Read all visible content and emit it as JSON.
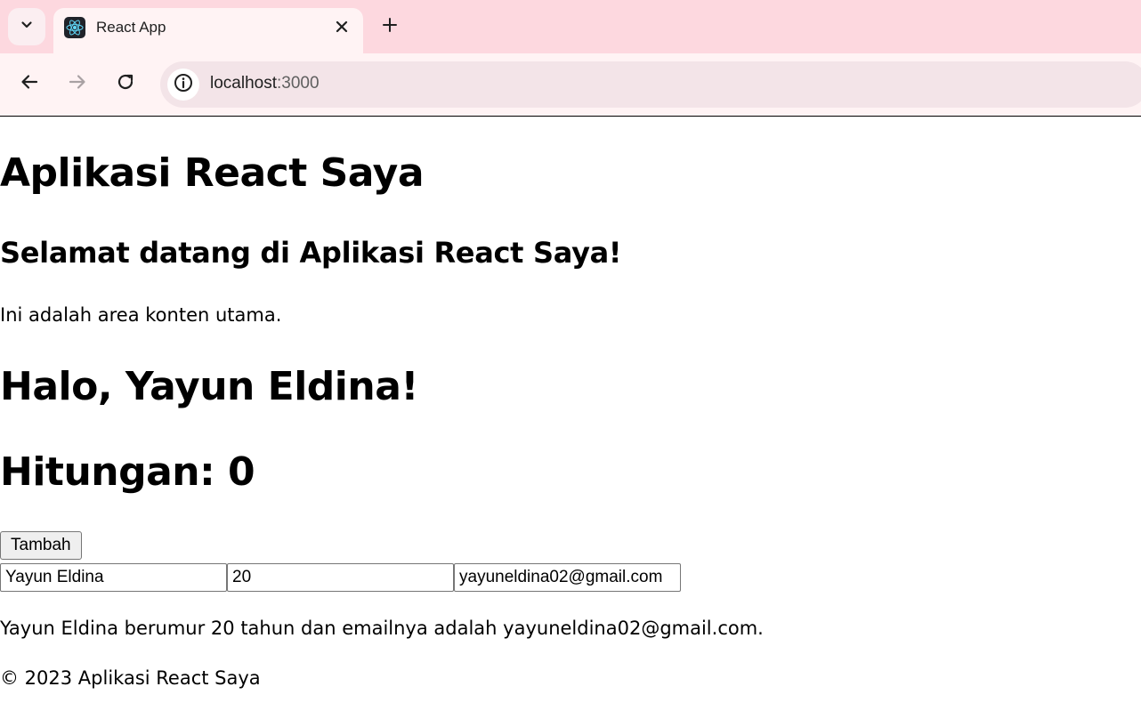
{
  "browser": {
    "tab": {
      "title": "React App",
      "favicon": "react-logo-icon"
    },
    "address_bar": {
      "host": "localhost",
      "port": ":3000"
    },
    "icons": {
      "tab_search": "chevron-down-icon",
      "close_tab": "close-icon",
      "new_tab": "plus-icon",
      "back": "arrow-left-icon",
      "forward": "arrow-right-icon",
      "reload": "reload-icon",
      "site_info": "info-icon"
    },
    "colors": {
      "tabstrip": "#fdd8df",
      "toolbar": "#fff3f4",
      "omnibox": "#f3e4e8",
      "react": "#61dafb"
    }
  },
  "page": {
    "app_title": "Aplikasi React Saya",
    "welcome_heading": "Selamat datang di Aplikasi React Saya!",
    "intro_text": "Ini adalah area konten utama.",
    "greeting": "Halo, Yayun Eldina!",
    "counter_label": "Hitungan: ",
    "counter_value": "0",
    "add_button_label": "Tambah",
    "form": {
      "name_value": "Yayun Eldina",
      "age_value": "20",
      "email_value": "yayuneldina02@gmail.com"
    },
    "summary": "Yayun Eldina berumur 20 tahun dan emailnya adalah yayuneldina02@gmail.com.",
    "footer": "© 2023 Aplikasi React Saya"
  }
}
